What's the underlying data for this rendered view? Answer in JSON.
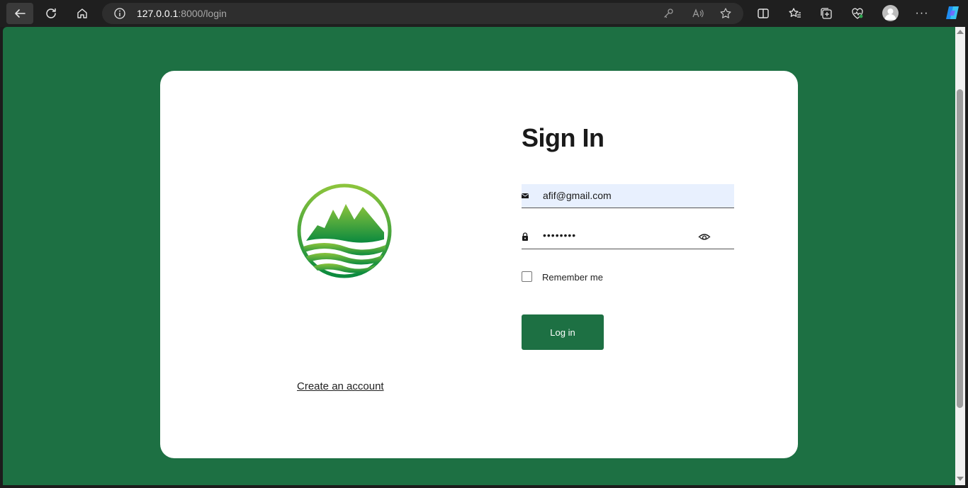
{
  "browser": {
    "url_host": "127.0.0.1",
    "url_rest": ":8000/login",
    "icons": {
      "back": "back-arrow-icon",
      "reload": "reload-icon",
      "home": "home-icon",
      "site_info": "info-icon",
      "password_key": "key-icon",
      "read_aloud": "read-aloud-icon",
      "favorite": "star-icon",
      "split_screen": "split-screen-icon",
      "favorites": "favorites-icon",
      "collections": "collections-icon",
      "health": "browser-essentials-icon",
      "profile": "avatar-icon",
      "more": "more-icon",
      "copilot": "copilot-icon"
    }
  },
  "colors": {
    "page_background": "#1d7043",
    "card_background": "#ffffff",
    "button_background": "#1d7043",
    "autofill_background": "#e8f0fe"
  },
  "login": {
    "title": "Sign In",
    "email_value": "afif@gmail.com",
    "password_value": "••••••••",
    "remember_label": "Remember me",
    "remember_checked": false,
    "login_button": "Log in",
    "create_account": "Create an account"
  }
}
